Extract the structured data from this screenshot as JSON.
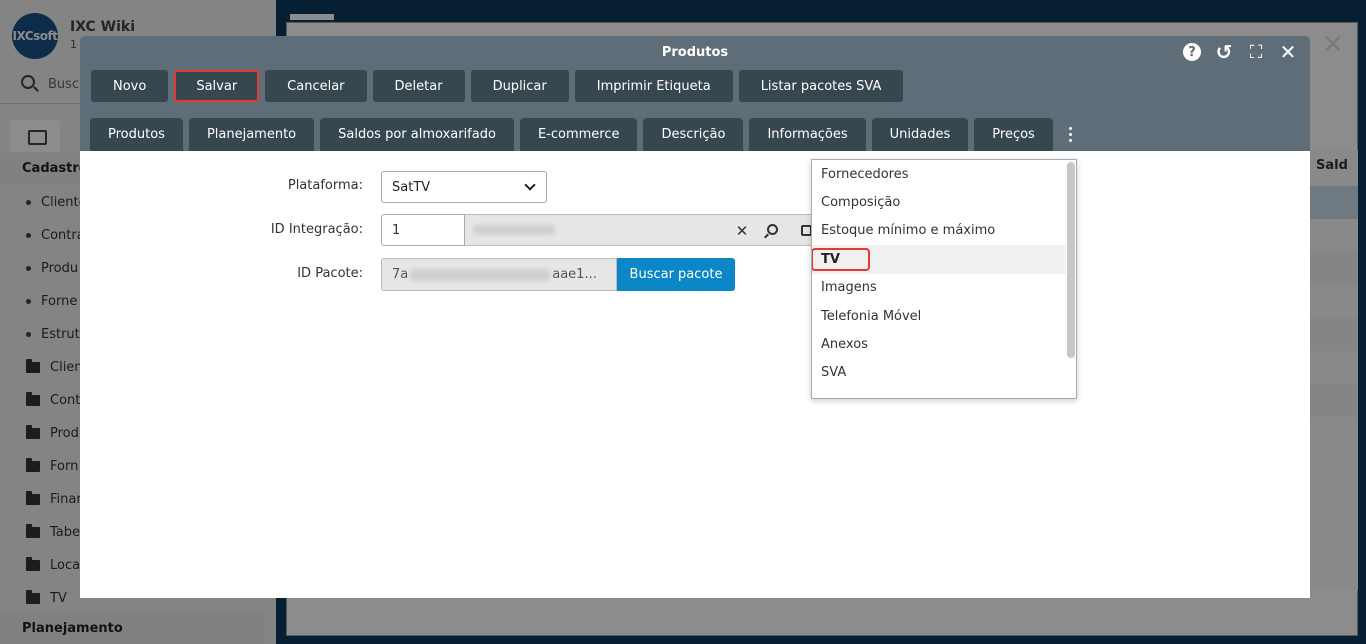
{
  "background": {
    "app_title": "IXC Wiki",
    "app_sub": "1",
    "logo_text": "IXCsoft",
    "search_placeholder": "Busc",
    "section_cadastros": "Cadastro",
    "section_planejamento": "Planejamento",
    "nav_items": [
      {
        "label": "Cliente",
        "kind": "dot"
      },
      {
        "label": "Contra",
        "kind": "dot"
      },
      {
        "label": "Produ",
        "kind": "dot"
      },
      {
        "label": "Forne",
        "kind": "dot"
      },
      {
        "label": "Estrutu",
        "kind": "dot"
      },
      {
        "label": "Clien",
        "kind": "folder"
      },
      {
        "label": "Cont",
        "kind": "folder"
      },
      {
        "label": "Prod",
        "kind": "folder"
      },
      {
        "label": "Forn",
        "kind": "folder"
      },
      {
        "label": "Finan",
        "kind": "folder"
      },
      {
        "label": "Tabe",
        "kind": "folder"
      },
      {
        "label": "Loca",
        "kind": "folder"
      },
      {
        "label": "TV",
        "kind": "folder"
      }
    ],
    "right_header": "Sald"
  },
  "modal": {
    "title": "Produtos",
    "header_icons": [
      "help-icon",
      "history-icon",
      "fullscreen-icon",
      "close-icon"
    ],
    "help_glyph": "?",
    "history_glyph": "↺",
    "fullscreen_glyph": "⛶",
    "close_glyph": "✕",
    "toolbar": [
      {
        "label": "Novo",
        "name": "novo-button"
      },
      {
        "label": "Salvar",
        "name": "salvar-button",
        "highlighted": true
      },
      {
        "label": "Cancelar",
        "name": "cancelar-button"
      },
      {
        "label": "Deletar",
        "name": "deletar-button"
      },
      {
        "label": "Duplicar",
        "name": "duplicar-button"
      },
      {
        "label": "Imprimir Etiqueta",
        "name": "imprimir-etiqueta-button"
      },
      {
        "label": "Listar pacotes SVA",
        "name": "listar-pacotes-sva-button"
      }
    ],
    "tabs": [
      {
        "label": "Produtos"
      },
      {
        "label": "Planejamento"
      },
      {
        "label": "Saldos por almoxarifado"
      },
      {
        "label": "E-commerce"
      },
      {
        "label": "Descrição"
      },
      {
        "label": "Informações"
      },
      {
        "label": "Unidades"
      },
      {
        "label": "Preços"
      }
    ],
    "form": {
      "plataforma_label": "Plataforma:",
      "plataforma_value": "SatTV",
      "id_integracao_label": "ID Integração:",
      "id_integracao_value": "1",
      "id_clear_glyph": "✕",
      "id_pacote_label": "ID Pacote:",
      "id_pacote_prefix": "7a",
      "id_pacote_suffix": "aae1...",
      "buscar_pacote_label": "Buscar pacote"
    },
    "dropdown": {
      "items": [
        "Fornecedores",
        "Composição",
        "Estoque mínimo e máximo",
        "TV",
        "Imagens",
        "Telefonia Móvel",
        "Anexos",
        "SVA"
      ],
      "selected_index": 3
    }
  }
}
